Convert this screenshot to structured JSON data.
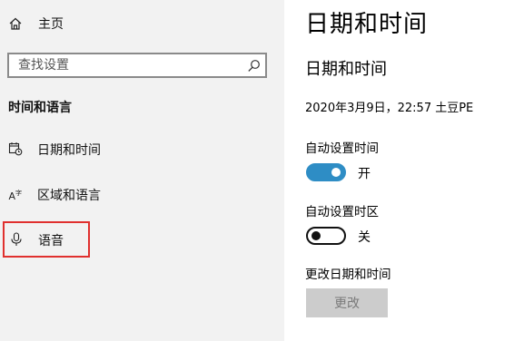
{
  "sidebar": {
    "home": {
      "label": "主页",
      "icon": "home-icon"
    },
    "search": {
      "placeholder": "查找设置",
      "icon": "search-icon"
    },
    "section_title": "时间和语言",
    "items": [
      {
        "label": "日期和时间",
        "icon": "calendar-clock-icon",
        "selected": false
      },
      {
        "label": "区域和语言",
        "icon": "language-icon",
        "selected": false
      },
      {
        "label": "语音",
        "icon": "microphone-icon",
        "selected": true
      }
    ],
    "highlight_color": "#e0302e"
  },
  "main": {
    "page_title": "日期和时间",
    "sub_title": "日期和时间",
    "current_datetime": "2020年3月9日，22:57 土豆PE",
    "auto_time": {
      "label": "自动设置时间",
      "state": "开",
      "on": true
    },
    "auto_timezone": {
      "label": "自动设置时区",
      "state": "关",
      "on": false
    },
    "change_section_label": "更改日期和时间",
    "change_button": "更改"
  },
  "colors": {
    "accent": "#2e8dc5",
    "sidebar_bg": "#f2f2f2",
    "disabled_button_bg": "#cccccc"
  }
}
